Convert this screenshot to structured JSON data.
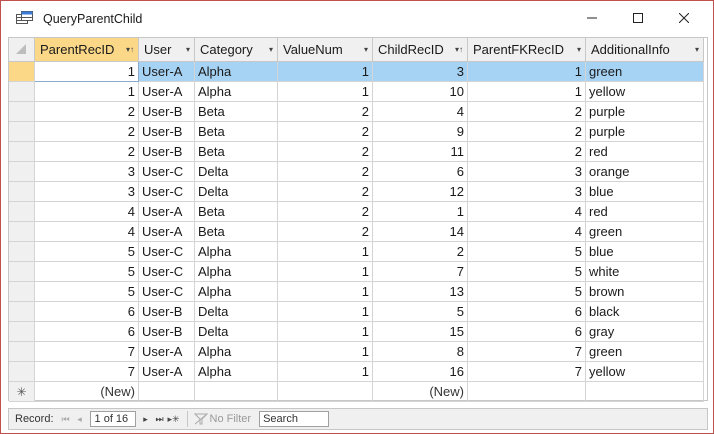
{
  "window": {
    "title": "QueryParentChild"
  },
  "columns": [
    {
      "label": "ParentRecID",
      "sorted": true
    },
    {
      "label": "User",
      "sorted": false
    },
    {
      "label": "Category",
      "sorted": false
    },
    {
      "label": "ValueNum",
      "sorted": false
    },
    {
      "label": "ChildRecID",
      "sorted": true
    },
    {
      "label": "ParentFKRecID",
      "sorted": false
    },
    {
      "label": "AdditionalInfo",
      "sorted": false
    }
  ],
  "rows": [
    [
      "1",
      "User-A",
      "Alpha",
      "1",
      "3",
      "1",
      "green"
    ],
    [
      "1",
      "User-A",
      "Alpha",
      "1",
      "10",
      "1",
      "yellow"
    ],
    [
      "2",
      "User-B",
      "Beta",
      "2",
      "4",
      "2",
      "purple"
    ],
    [
      "2",
      "User-B",
      "Beta",
      "2",
      "9",
      "2",
      "purple"
    ],
    [
      "2",
      "User-B",
      "Beta",
      "2",
      "11",
      "2",
      "red"
    ],
    [
      "3",
      "User-C",
      "Delta",
      "2",
      "6",
      "3",
      "orange"
    ],
    [
      "3",
      "User-C",
      "Delta",
      "2",
      "12",
      "3",
      "blue"
    ],
    [
      "4",
      "User-A",
      "Beta",
      "2",
      "1",
      "4",
      "red"
    ],
    [
      "4",
      "User-A",
      "Beta",
      "2",
      "14",
      "4",
      "green"
    ],
    [
      "5",
      "User-C",
      "Alpha",
      "1",
      "2",
      "5",
      "blue"
    ],
    [
      "5",
      "User-C",
      "Alpha",
      "1",
      "7",
      "5",
      "white"
    ],
    [
      "5",
      "User-C",
      "Alpha",
      "1",
      "13",
      "5",
      "brown"
    ],
    [
      "6",
      "User-B",
      "Delta",
      "1",
      "5",
      "6",
      "black"
    ],
    [
      "6",
      "User-B",
      "Delta",
      "1",
      "15",
      "6",
      "gray"
    ],
    [
      "7",
      "User-A",
      "Alpha",
      "1",
      "8",
      "7",
      "green"
    ],
    [
      "7",
      "User-A",
      "Alpha",
      "1",
      "16",
      "7",
      "yellow"
    ]
  ],
  "new_row": {
    "parent_placeholder": "(New)",
    "child_placeholder": "(New)",
    "marker": "✳"
  },
  "navigation": {
    "record_label": "Record:",
    "current": "1 of 16",
    "filter_label": "No Filter",
    "search_label": "Search"
  },
  "colors": {
    "selected_row": "#a6d2f4",
    "current_header": "#fbd888",
    "border": "#c0504d"
  }
}
